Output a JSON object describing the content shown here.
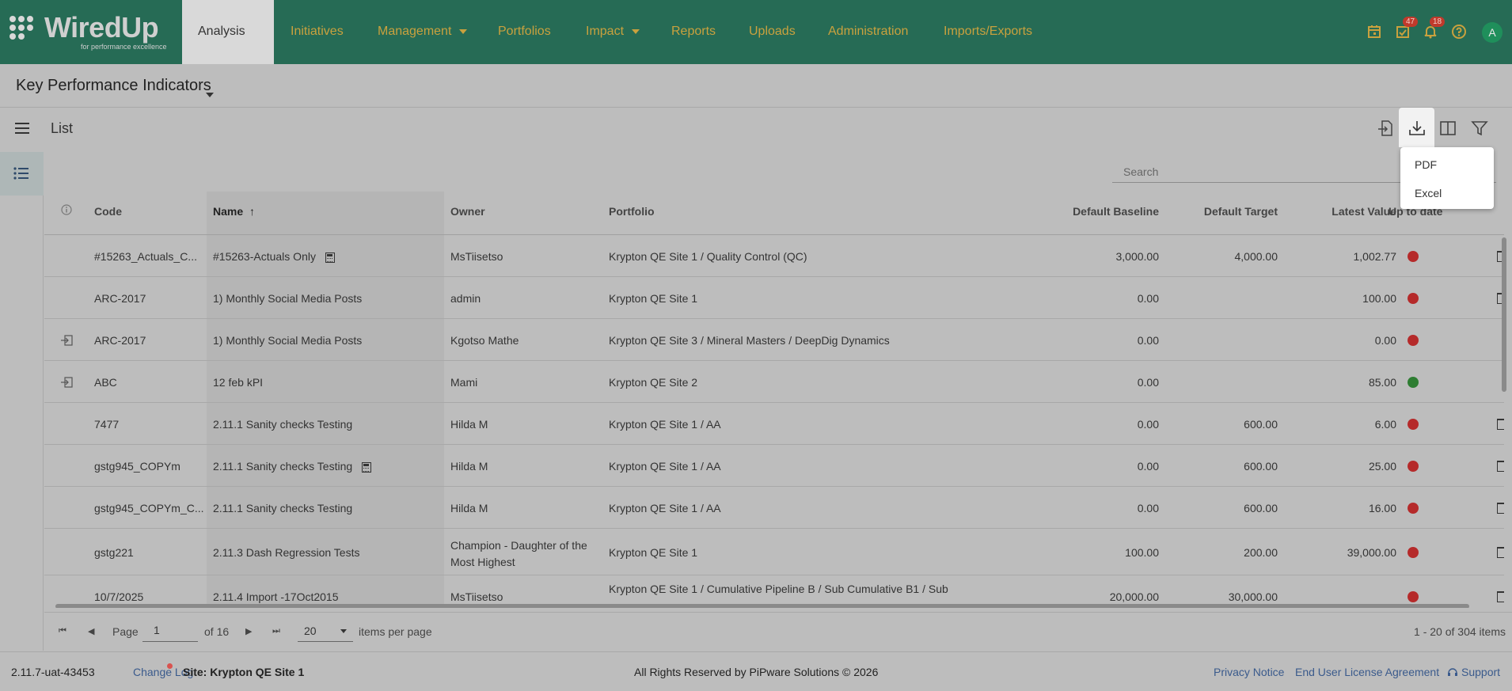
{
  "app": {
    "logo_text": "WiredUp",
    "logo_tagline": "for performance excellence"
  },
  "nav": {
    "items": [
      {
        "label": "Analysis",
        "has_caret": true,
        "active": true
      },
      {
        "label": "Initiatives",
        "has_caret": false
      },
      {
        "label": "Management",
        "has_caret": true
      },
      {
        "label": "Portfolios",
        "has_caret": false
      },
      {
        "label": "Impact",
        "has_caret": true
      },
      {
        "label": "Reports",
        "has_caret": false
      },
      {
        "label": "Uploads",
        "has_caret": false
      },
      {
        "label": "Administration",
        "has_caret": false
      },
      {
        "label": "Imports/Exports",
        "has_caret": false
      }
    ],
    "icons": {
      "calendar": "calendar-icon",
      "tasks": "task-check-icon",
      "tasks_badge": "47",
      "notifications": "bell-icon",
      "notifications_badge": "18",
      "help": "help-icon"
    },
    "avatar_initial": "A"
  },
  "page": {
    "title": "Key Performance Indicators",
    "list_label": "List"
  },
  "search": {
    "placeholder": "Search"
  },
  "export_menu": {
    "items": [
      "PDF",
      "Excel"
    ]
  },
  "table": {
    "headers": {
      "code": "Code",
      "name": "Name",
      "name_sort": "↑",
      "owner": "Owner",
      "portfolio": "Portfolio",
      "baseline": "Default Baseline",
      "target": "Default Target",
      "latest": "Latest Value",
      "uptodate": "Up to date"
    },
    "rows": [
      {
        "code": "#15263_Actuals_C...",
        "name": "#15263-Actuals Only",
        "calc": true,
        "owner": "MsTiisetso",
        "owner2": "",
        "portfolio": "Krypton QE Site 1 / Quality Control (QC)",
        "portfolio2": "",
        "baseline": "3,000.00",
        "target": "4,000.00",
        "latest": "1,002.77",
        "status": "red",
        "linked": false,
        "trash": true
      },
      {
        "code": "ARC-2017",
        "name": "1) Monthly Social Media Posts",
        "calc": false,
        "owner": "admin",
        "owner2": "",
        "portfolio": "Krypton QE Site 1",
        "portfolio2": "",
        "baseline": "0.00",
        "target": "",
        "latest": "100.00",
        "status": "red",
        "linked": false,
        "trash": true
      },
      {
        "code": "ARC-2017",
        "name": "1) Monthly Social Media Posts",
        "calc": false,
        "owner": "Kgotso Mathe",
        "owner2": "",
        "portfolio": "Krypton QE Site 3 / Mineral Masters / DeepDig Dynamics",
        "portfolio2": "",
        "baseline": "0.00",
        "target": "",
        "latest": "0.00",
        "status": "red",
        "linked": true,
        "trash": false
      },
      {
        "code": "ABC",
        "name": "12 feb kPI",
        "calc": false,
        "owner": "Mami",
        "owner2": "",
        "portfolio": "Krypton QE Site 2",
        "portfolio2": "",
        "baseline": "0.00",
        "target": "",
        "latest": "85.00",
        "status": "green",
        "linked": true,
        "trash": false
      },
      {
        "code": "7477",
        "name": "2.11.1 Sanity checks Testing",
        "calc": false,
        "owner": "Hilda M",
        "owner2": "",
        "portfolio": "Krypton QE Site 1 / AA",
        "portfolio2": "",
        "baseline": "0.00",
        "target": "600.00",
        "latest": "6.00",
        "status": "red",
        "linked": false,
        "trash": true
      },
      {
        "code": "gstg945_COPYm",
        "name": "2.11.1 Sanity checks Testing",
        "calc": true,
        "owner": "Hilda M",
        "owner2": "",
        "portfolio": "Krypton QE Site 1 / AA",
        "portfolio2": "",
        "baseline": "0.00",
        "target": "600.00",
        "latest": "25.00",
        "status": "red",
        "linked": false,
        "trash": true
      },
      {
        "code": "gstg945_COPYm_C...",
        "name": "2.11.1 Sanity checks Testing",
        "calc": false,
        "owner": "Hilda M",
        "owner2": "",
        "portfolio": "Krypton QE Site 1 / AA",
        "portfolio2": "",
        "baseline": "0.00",
        "target": "600.00",
        "latest": "16.00",
        "status": "red",
        "linked": false,
        "trash": true
      },
      {
        "code": "gstg221",
        "name": "2.11.3 Dash Regression Tests",
        "calc": false,
        "owner": "Champion - Daughter of the",
        "owner2": "Most Highest",
        "portfolio": "Krypton QE Site 1",
        "portfolio2": "",
        "baseline": "100.00",
        "target": "200.00",
        "latest": "39,000.00",
        "status": "red",
        "linked": false,
        "trash": true
      },
      {
        "code": "10/7/2025",
        "name": "2.11.4 Import -17Oct2015",
        "calc": false,
        "owner": "MsTiisetso",
        "owner2": "",
        "portfolio": "Krypton QE Site 1 / Cumulative Pipeline B / Sub Cumulative B1 / Sub",
        "portfolio2": "",
        "baseline": "20,000.00",
        "target": "30,000.00",
        "latest": "",
        "status": "red",
        "linked": false,
        "trash": true
      }
    ]
  },
  "pager": {
    "page_label": "Page",
    "page_value": "1",
    "of_label": "of 16",
    "per_page_value": "20",
    "per_page_label": "items per page",
    "summary": "1 - 20 of 304 items"
  },
  "footer": {
    "version": "2.11.7-uat-43453",
    "change_log": "Change Log",
    "site": "Site: Krypton QE Site 1",
    "copyright": "All Rights Reserved by PiPware Solutions © 2026",
    "privacy": "Privacy Notice",
    "eula": "End User License Agreement",
    "support": "Support"
  },
  "colors": {
    "header_bg": "#266b55",
    "nav_text": "#c9a13e",
    "status_red": "#b52a2a",
    "status_green": "#2e7d32",
    "link": "#3a5a8c"
  }
}
